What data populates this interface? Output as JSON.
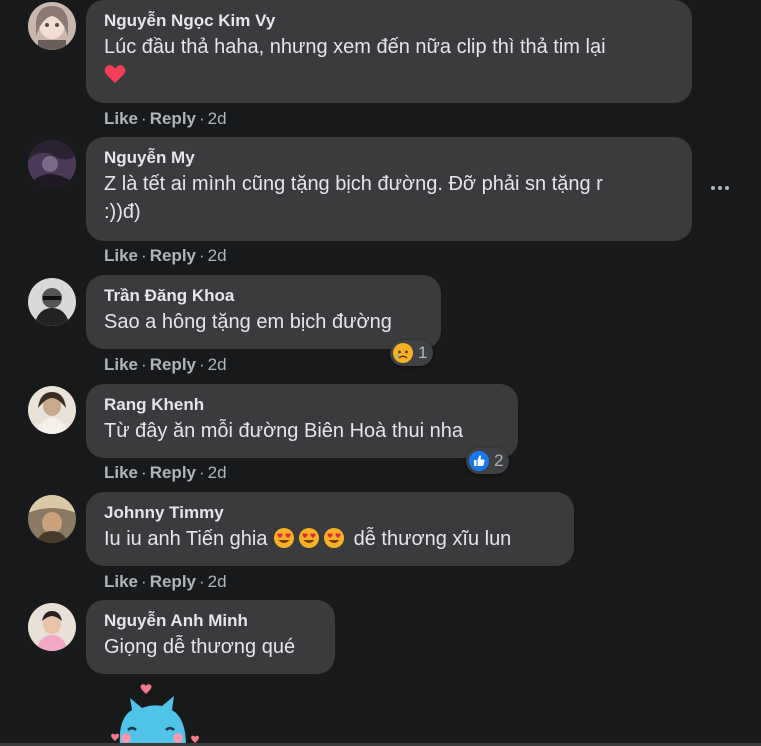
{
  "comments": [
    {
      "author": "Nguyễn Ngọc Kim Vy",
      "text": "Lúc đầu thả haha, nhưng xem đến nữa clip thì thả tim lại",
      "like": "Like",
      "reply": "Reply",
      "sep": "·",
      "time": "2d"
    },
    {
      "author": "Nguyễn My",
      "text_line1": "Z là tết ai mình cũng tặng bịch đường. Đỡ phải sn tặng r",
      "text_line2": ":))đ)",
      "like": "Like",
      "reply": "Reply",
      "sep": "·",
      "time": "2d"
    },
    {
      "author": "Trần Đăng Khoa",
      "text": "Sao a hông tặng em bịch đường",
      "like": "Like",
      "reply": "Reply",
      "sep": "·",
      "time": "2d",
      "reaction_count": "1",
      "reaction_icon": "sad-face-icon"
    },
    {
      "author": "Rang Khenh",
      "text": "Từ đây ăn mỗi đường Biên Hoà thui nha",
      "like": "Like",
      "reply": "Reply",
      "sep": "·",
      "time": "2d",
      "reaction_count": "2",
      "reaction_icon": "thumbs-up-icon"
    },
    {
      "author": "Johnny Timmy",
      "text_before": "Iu iu anh Tiến ghia",
      "text_after": "dễ thương xĩu lun",
      "like": "Like",
      "reply": "Reply",
      "sep": "·",
      "time": "2d"
    },
    {
      "author": "Nguyễn Anh Minh",
      "text": "Giọng dễ thương qué"
    }
  ],
  "colors": {
    "background": "#18191a",
    "bubble": "#3a3b3c",
    "text": "#e4e6eb",
    "secondary": "#b0b3b8",
    "like_blue": "#1877f2",
    "heart_red": "#f33e58"
  }
}
